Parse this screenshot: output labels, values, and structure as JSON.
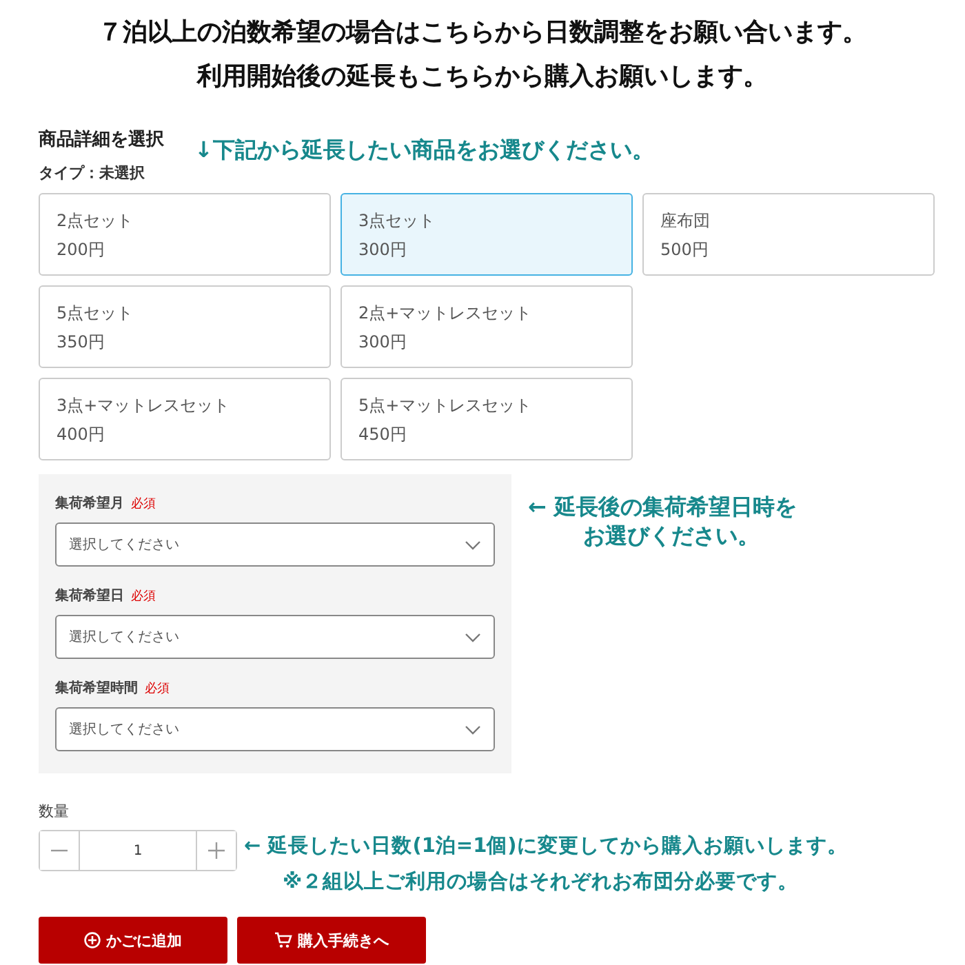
{
  "header": [
    "７泊以上の泊数希望の場合はこちらから日数調整をお願い合います。",
    "利用開始後の延長もこちらから購入お願いします。"
  ],
  "product_section": {
    "title": "商品詳細を選択",
    "note": "↓下記から延長したい商品をお選びください。",
    "type_label": "タイプ：未選択",
    "option_rows": [
      [
        {
          "name": "2点セット",
          "price": "200円",
          "selected": false
        },
        {
          "name": "3点セット",
          "price": "300円",
          "selected": true
        },
        {
          "name": "座布団",
          "price": "500円",
          "selected": false
        }
      ],
      [
        {
          "name": "5点セット",
          "price": "350円",
          "selected": false
        },
        {
          "name": "2点+マットレスセット",
          "price": "300円",
          "selected": false
        }
      ],
      [
        {
          "name": "3点+マットレスセット",
          "price": "400円",
          "selected": false
        },
        {
          "name": "5点+マットレスセット",
          "price": "450円",
          "selected": false
        }
      ]
    ]
  },
  "pickup": {
    "note": [
      "← 延長後の集荷希望日時を",
      "お選びください。"
    ],
    "fields": [
      {
        "label": "集荷希望月",
        "required": "必須",
        "placeholder": "選択してください"
      },
      {
        "label": "集荷希望日",
        "required": "必須",
        "placeholder": "選択してください"
      },
      {
        "label": "集荷希望時間",
        "required": "必須",
        "placeholder": "選択してください"
      }
    ]
  },
  "quantity": {
    "label": "数量",
    "value": "1",
    "note": [
      "← 延長したい日数(1泊=1個)に変更してから購入お願いします。",
      "※２組以上ご利用の場合はそれぞれお布団分必要です。"
    ]
  },
  "buttons": [
    {
      "kind": "add",
      "label": "かごに追加"
    },
    {
      "kind": "checkout",
      "label": "購入手続きへ"
    }
  ]
}
